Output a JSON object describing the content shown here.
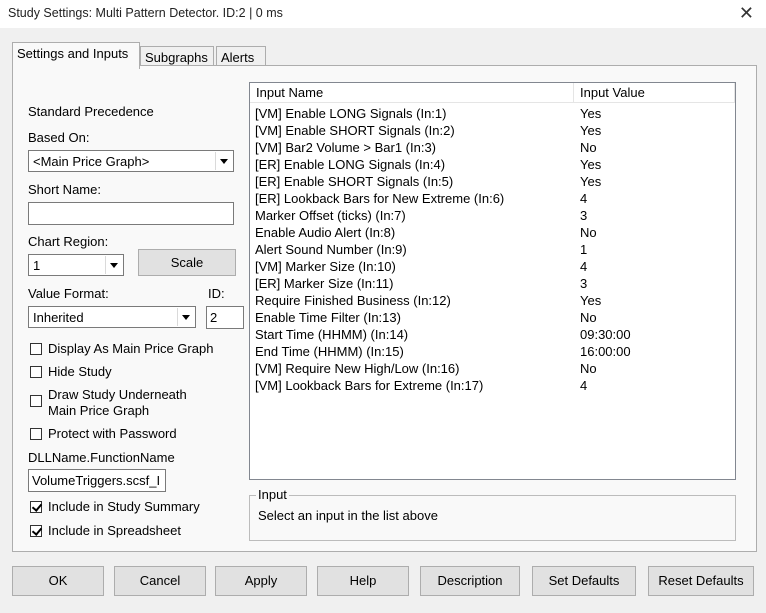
{
  "window": {
    "title": "Study Settings: Multi Pattern Detector. ID:2 | 0 ms",
    "close_glyph": "✕"
  },
  "tabs": [
    {
      "label": "Settings and Inputs"
    },
    {
      "label": "Subgraphs"
    },
    {
      "label": "Alerts"
    }
  ],
  "left": {
    "standard_precedence": "Standard Precedence",
    "based_on_label": "Based On:",
    "based_on_value": "<Main Price Graph>",
    "short_name_label": "Short Name:",
    "short_name_value": "",
    "chart_region_label": "Chart Region:",
    "chart_region_value": "1",
    "scale_button": "Scale",
    "value_format_label": "Value Format:",
    "value_format_value": "Inherited",
    "id_label": "ID:",
    "id_value": "2",
    "checkboxes": [
      {
        "label": "Display As Main Price Graph",
        "checked": false
      },
      {
        "label": "Hide Study",
        "checked": false
      },
      {
        "label": "Draw Study Underneath\nMain Price Graph",
        "checked": false
      },
      {
        "label": "Protect with Password",
        "checked": false
      }
    ],
    "dll_label": "DLLName.FunctionName",
    "dll_value": "VolumeTriggers.scsf_I",
    "include_summary": {
      "label": "Include in Study Summary",
      "checked": true
    },
    "include_spreadsheet": {
      "label": "Include in Spreadsheet",
      "checked": true
    }
  },
  "inputs_table": {
    "columns": [
      "Input Name",
      "Input Value"
    ],
    "rows": [
      [
        "[VM] Enable LONG Signals  (In:1)",
        "Yes"
      ],
      [
        "[VM] Enable SHORT Signals  (In:2)",
        "Yes"
      ],
      [
        "[VM] Bar2 Volume > Bar1  (In:3)",
        "No"
      ],
      [
        "[ER] Enable LONG Signals  (In:4)",
        "Yes"
      ],
      [
        "[ER] Enable SHORT Signals  (In:5)",
        "Yes"
      ],
      [
        "[ER] Lookback Bars for New Extreme  (In:6)",
        "4"
      ],
      [
        "Marker Offset (ticks)  (In:7)",
        "3"
      ],
      [
        "Enable Audio Alert  (In:8)",
        "No"
      ],
      [
        "Alert Sound Number  (In:9)",
        "1"
      ],
      [
        "[VM] Marker Size  (In:10)",
        "4"
      ],
      [
        "[ER] Marker Size  (In:11)",
        "3"
      ],
      [
        "Require Finished Business  (In:12)",
        "Yes"
      ],
      [
        "Enable Time Filter  (In:13)",
        "No"
      ],
      [
        "Start Time (HHMM)  (In:14)",
        "09:30:00"
      ],
      [
        "End Time (HHMM)  (In:15)",
        "16:00:00"
      ],
      [
        "[VM] Require New High/Low  (In:16)",
        "No"
      ],
      [
        "[VM] Lookback Bars for Extreme  (In:17)",
        "4"
      ]
    ]
  },
  "input_group": {
    "title": "Input",
    "text": "Select an input in the list above"
  },
  "buttons": [
    {
      "label": "OK"
    },
    {
      "label": "Cancel"
    },
    {
      "label": "Apply"
    },
    {
      "label": "Help"
    },
    {
      "label": "Description"
    },
    {
      "label": "Set Defaults"
    },
    {
      "label": "Reset Defaults"
    }
  ]
}
